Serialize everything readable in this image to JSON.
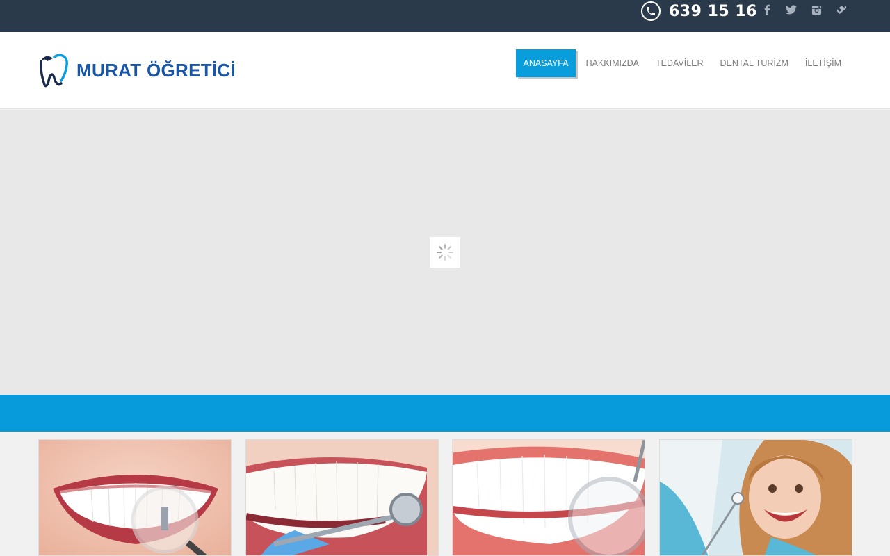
{
  "topbar": {
    "phone_number": "639 15 16",
    "phone_icon": "phone-icon",
    "social": [
      {
        "name": "facebook-icon",
        "glyph": "f"
      },
      {
        "name": "twitter-icon",
        "glyph": "t"
      },
      {
        "name": "instagram-icon",
        "glyph": "ig"
      },
      {
        "name": "foursquare-icon",
        "glyph": "fs"
      }
    ]
  },
  "header": {
    "logo_text": "MURAT ÖĞRETİCİ",
    "nav": {
      "home": "ANASAYFA",
      "about": "HAKKIMIZDA",
      "treatments": "TEDAVİLER",
      "dental_tourism": "DENTAL TURİZM",
      "contact": "İLETİŞİM"
    }
  },
  "colors": {
    "topbar": "#2b3a4b",
    "brand_blue": "#0a9ddc",
    "logo_blue": "#1a56a8",
    "slider_bg": "#e8e8e8"
  },
  "slider": {
    "loading_icon": "spinner-icon"
  },
  "cards": [
    {
      "name": "implant-card",
      "image": "smile-with-magnifier"
    },
    {
      "name": "dental-check-card",
      "image": "teeth-with-dental-tools"
    },
    {
      "name": "whitening-card",
      "image": "white-teeth-with-mirror"
    },
    {
      "name": "pediatric-card",
      "image": "child-at-dentist"
    }
  ]
}
